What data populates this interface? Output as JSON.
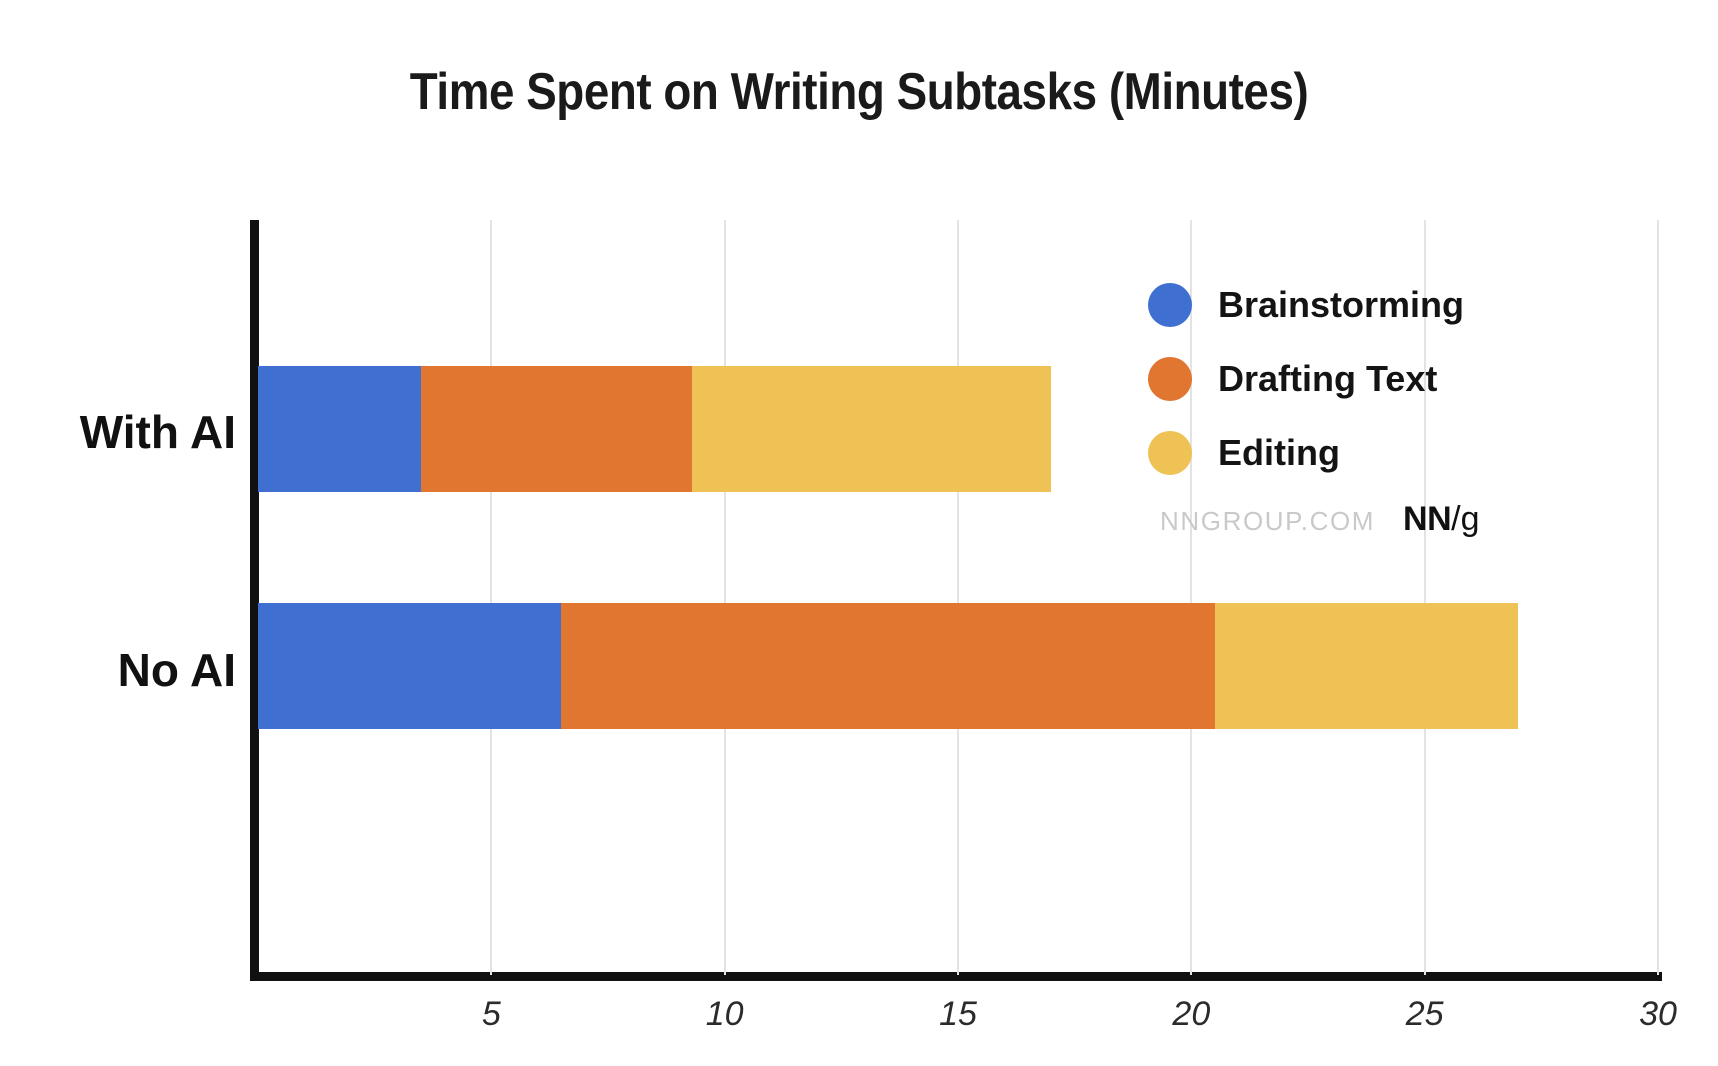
{
  "chart_data": {
    "type": "bar",
    "orientation": "horizontal",
    "stacked": true,
    "title": "Time Spent on Writing Subtasks (Minutes)",
    "xlabel": "",
    "ylabel": "",
    "xlim": [
      0,
      30
    ],
    "xticks": [
      5,
      10,
      15,
      20,
      25,
      30
    ],
    "xtick_labels": [
      "5",
      "10",
      "15",
      "20",
      "25",
      "30"
    ],
    "grid": "vertical",
    "legend_position": "top-right",
    "categories": [
      "With AI",
      "No AI"
    ],
    "series": [
      {
        "name": "Brainstorming",
        "color": "#3F6FD0",
        "values": [
          3.5,
          6.5
        ]
      },
      {
        "name": "Drafting Text",
        "color": "#E0762F",
        "values": [
          5.8,
          14.0
        ]
      },
      {
        "name": "Editing",
        "color": "#EEC254",
        "values": [
          7.7,
          6.5
        ]
      }
    ],
    "totals": [
      17.0,
      27.0
    ]
  },
  "legend": {
    "items": [
      {
        "label": "Brainstorming",
        "color": "#3F6FD0",
        "swatch": "circle-swatch-icon"
      },
      {
        "label": "Drafting Text",
        "color": "#E0762F",
        "swatch": "circle-swatch-icon"
      },
      {
        "label": "Editing",
        "color": "#EEC254",
        "swatch": "circle-swatch-icon"
      }
    ]
  },
  "watermark": {
    "site": "NNGROUP.COM",
    "logo_nn": "NN",
    "logo_slash": "/",
    "logo_g": "g"
  },
  "colors": {
    "brainstorming": "#3F6FD0",
    "drafting": "#E0762F",
    "editing": "#EEC254",
    "axis": "#111111",
    "gridline": "#e3e3e3",
    "background": "#ffffff",
    "text": "#111111",
    "watermark_site": "#c9c9c9"
  }
}
